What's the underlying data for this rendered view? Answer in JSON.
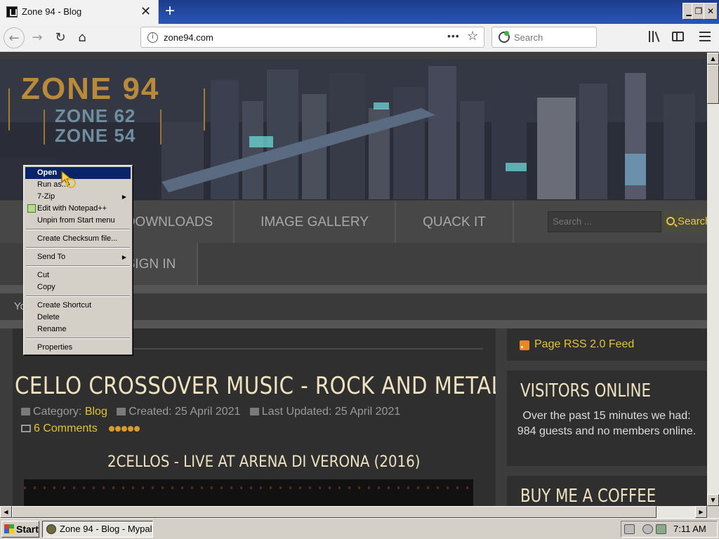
{
  "browser": {
    "tab_title": "Zone 94 - Blog",
    "tab_close": "✕",
    "new_tab": "+",
    "window_buttons": [
      "▁",
      "❐",
      "✕"
    ],
    "url": "zone94.com",
    "page_actions": "•••",
    "search_placeholder": "Search"
  },
  "site": {
    "logo": "ZONE 94",
    "logo_sub1": "ZONE 62",
    "logo_sub2": "ZONE 54",
    "nav_row1": [
      "DOWNLOADS",
      "IMAGE GALLERY",
      "QUACK IT"
    ],
    "nav_row2": [
      "SIGN IN"
    ],
    "search_placeholder": "Search ...",
    "search_button": "Search",
    "breadcrumb": "Yo"
  },
  "article": {
    "title": "CELLO CROSSOVER MUSIC - ROCK AND METAL",
    "category_label": "Category:",
    "category": "Blog",
    "created": "Created: 25 April 2021",
    "updated": "Last Updated: 25 April 2021",
    "comments": "6 Comments",
    "rating": 5,
    "video_title": "2CELLOS - LIVE AT ARENA DI VERONA (2016)"
  },
  "sidebar": {
    "rss": "Page RSS 2.0 Feed",
    "visitors_title": "VISITORS ONLINE",
    "visitors_text": "Over the past 15 minutes we had: 984 guests and no members online.",
    "coffee_title": "BUY ME A COFFEE"
  },
  "context_menu": {
    "items": [
      "Open",
      "Run as...",
      "7-Zip",
      "Edit with Notepad++",
      "Unpin from Start menu",
      "Create Checksum file...",
      "Send To",
      "Cut",
      "Copy",
      "Create Shortcut",
      "Delete",
      "Rename",
      "Properties"
    ]
  },
  "taskbar": {
    "start": "Start",
    "task": "Zone 94 - Blog - Mypal",
    "clock": "7:11 AM"
  }
}
